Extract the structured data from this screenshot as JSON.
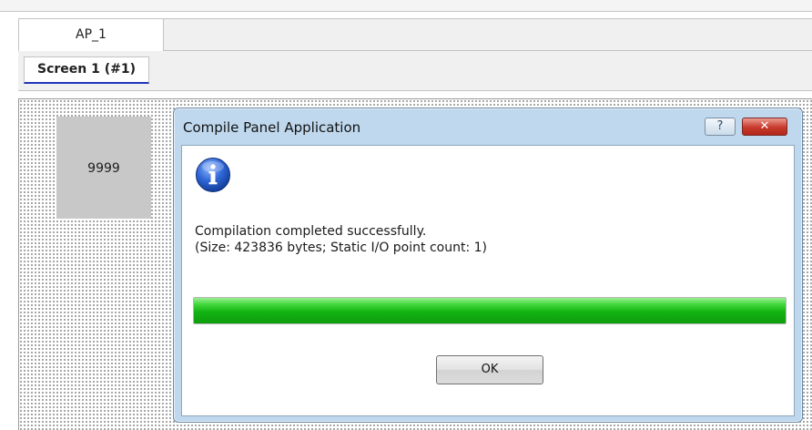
{
  "top_tab": {
    "label": "AP_1"
  },
  "screen_tab": {
    "label": "Screen 1 (#1)"
  },
  "canvas": {
    "placeholder_value": "9999"
  },
  "dialog": {
    "title": "Compile Panel Application",
    "help_label": "?",
    "close_label": "✕",
    "icon": "info-icon",
    "message_line1": "Compilation completed successfully.",
    "message_line2": "(Size: 423836 bytes; Static I/O point count: 1)",
    "progress_fraction": 1.0,
    "ok_label": "OK"
  },
  "colors": {
    "accent_tab_underline": "#1f35b6",
    "progress_green": "#12b312",
    "dialog_frame": "#bfd8ee",
    "close_button_red": "#c7392b"
  }
}
